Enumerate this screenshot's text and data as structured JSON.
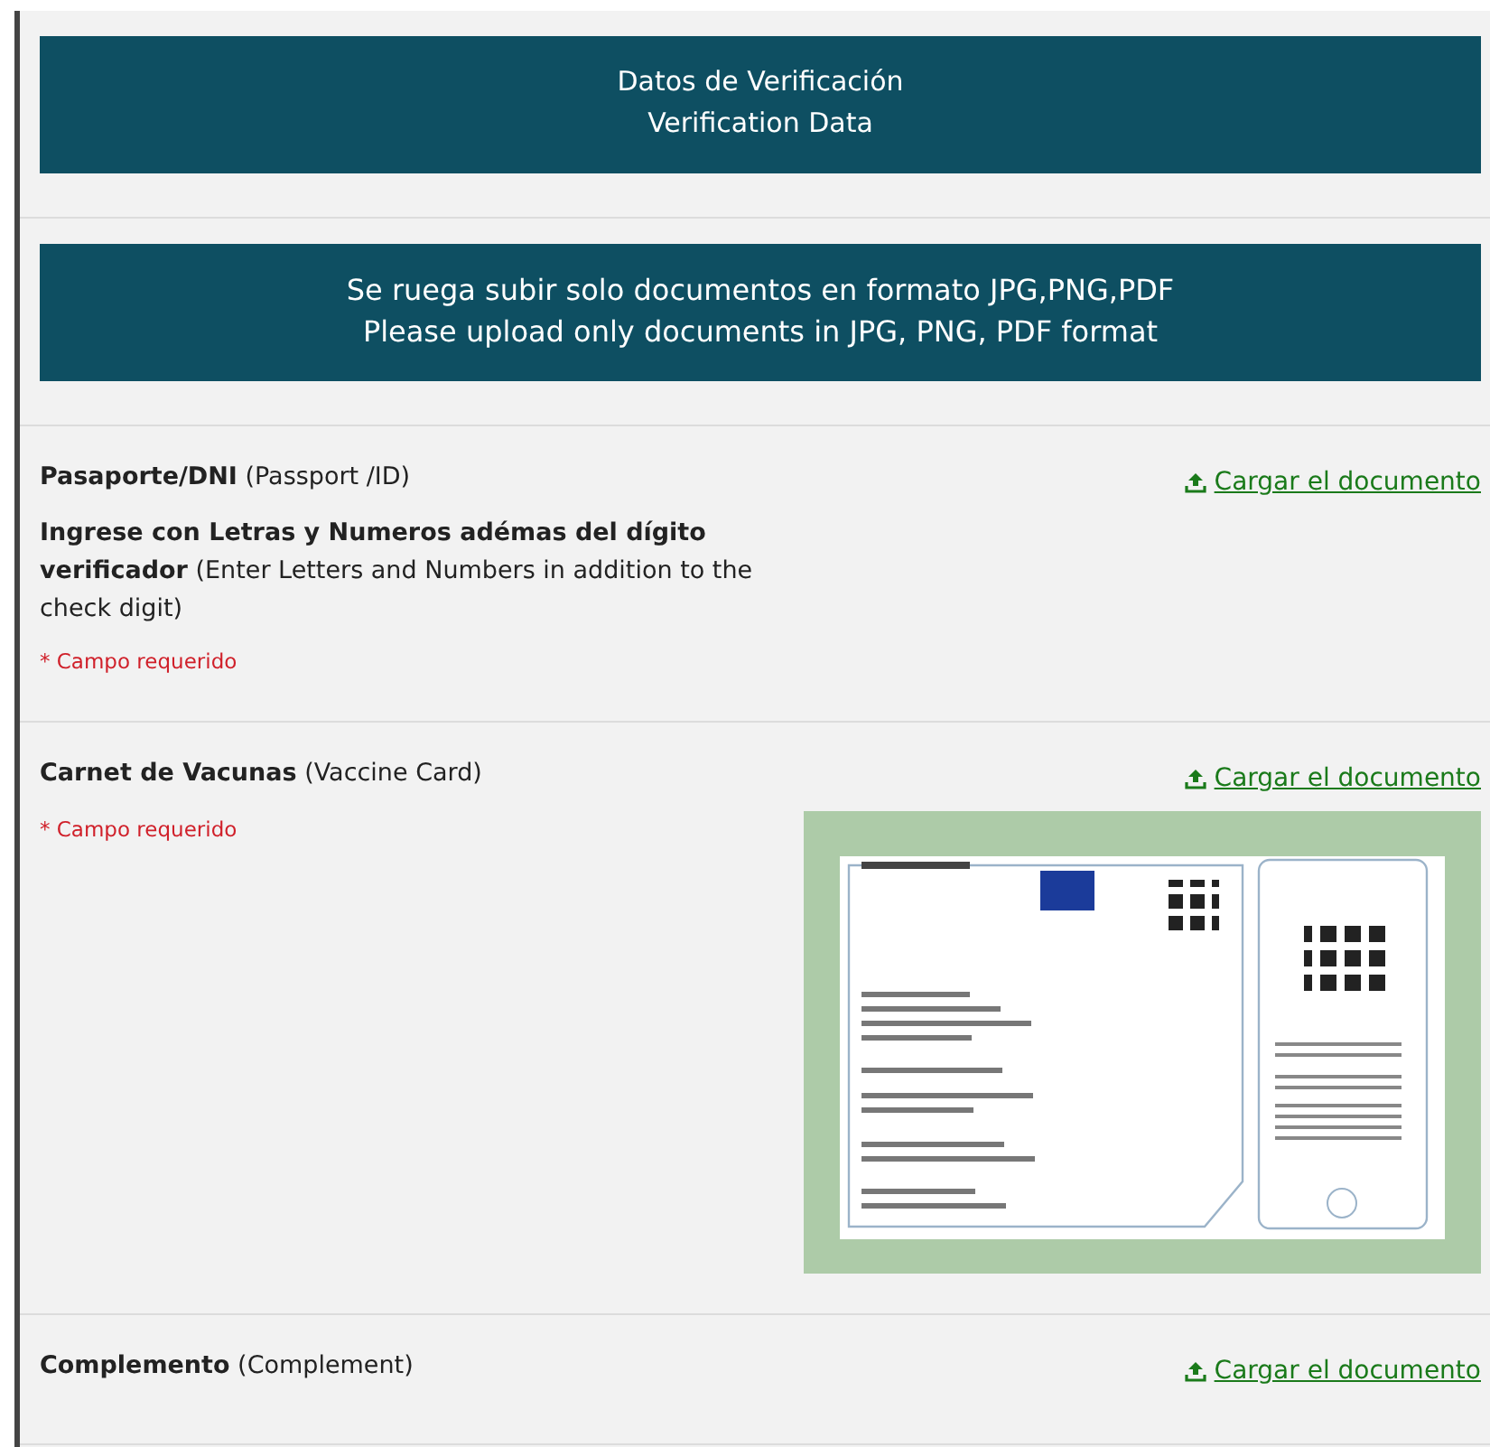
{
  "banners": [
    {
      "lines": [
        "Datos de Verificación",
        "Verification Data"
      ]
    },
    {
      "lines": [
        "Se ruega subir solo documentos en formato JPG,PNG,PDF",
        "Please upload only documents in JPG, PNG, PDF format"
      ]
    }
  ],
  "fields": [
    {
      "label": "Pasaporte/DNI",
      "label_en": "(Passport /ID)",
      "hint": "**Ingrese con Letras y Numeros adémas del dígito verificador** (Enter Letters and Numbers in addition to the check digit)",
      "required": "* Campo requerido",
      "upload": "Cargar el documento",
      "kind": "plain"
    },
    {
      "label": "Carnet de Vacunas",
      "label_en": "(Vaccine Card)",
      "required": "* Campo requerido",
      "upload": "Cargar el documento",
      "kind": "with_example"
    },
    {
      "label": "Complemento",
      "label_en": "(Complement)",
      "upload": "Cargar el documento",
      "kind": "plain"
    }
  ]
}
